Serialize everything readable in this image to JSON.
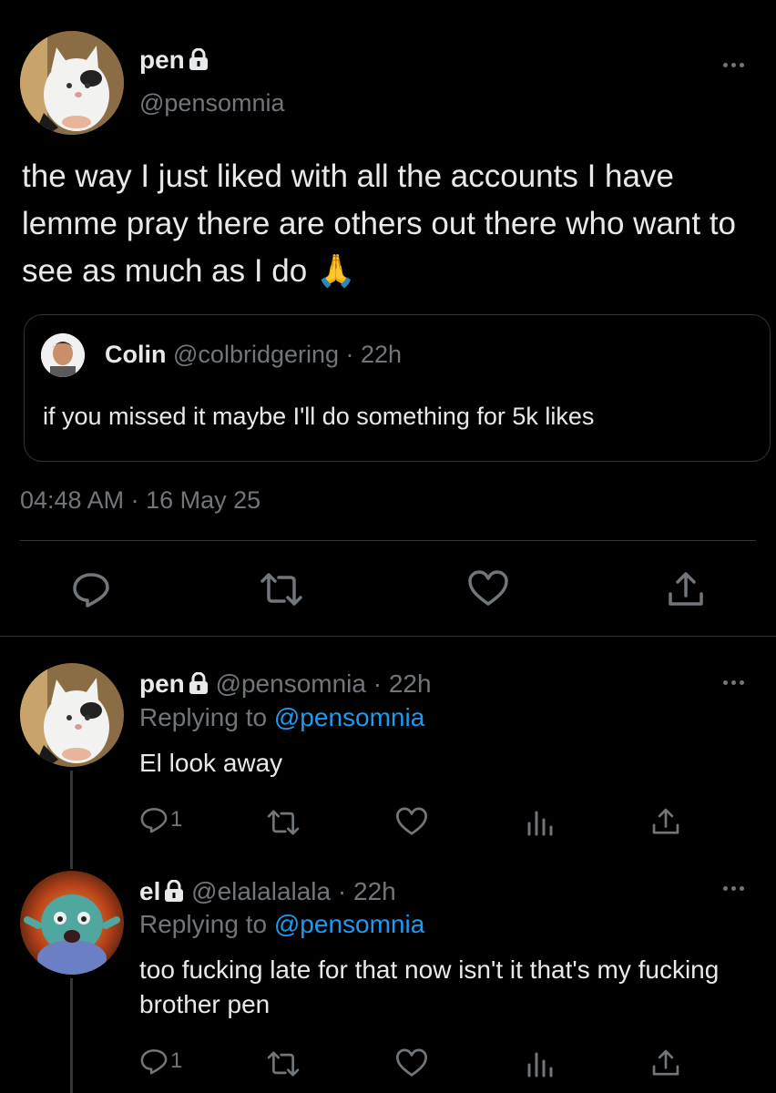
{
  "main_tweet": {
    "name": "pen",
    "handle": "@pensomnia",
    "text": "the way I just liked with all the accounts I have lemme pray there are others out there who want to see as much as I do",
    "emoji": "🙏",
    "timestamp": "04:48 AM",
    "dot": "·",
    "date": "16 May 25"
  },
  "quoted": {
    "name": "Colin",
    "handle": "@colbridgering",
    "time": "· 22h",
    "text": "if you missed it maybe I'll do something for 5k likes"
  },
  "replies": [
    {
      "name": "pen",
      "handle": "@pensomnia",
      "time": "· 22h",
      "replying_prefix": "Replying to",
      "replying_to": "@pensomnia",
      "text": "El look away",
      "reply_count": "1"
    },
    {
      "name": "el",
      "handle": "@elalalalala",
      "time": "· 22h",
      "replying_prefix": "Replying to",
      "replying_to": "@pensomnia",
      "text": "too fucking late for that now isn't it that's my fucking brother pen",
      "reply_count": "1"
    }
  ],
  "colors": {
    "background": "#000000",
    "text": "#e7e9ea",
    "muted": "#71767b",
    "link": "#1d9bf0",
    "border": "#2f3336"
  }
}
